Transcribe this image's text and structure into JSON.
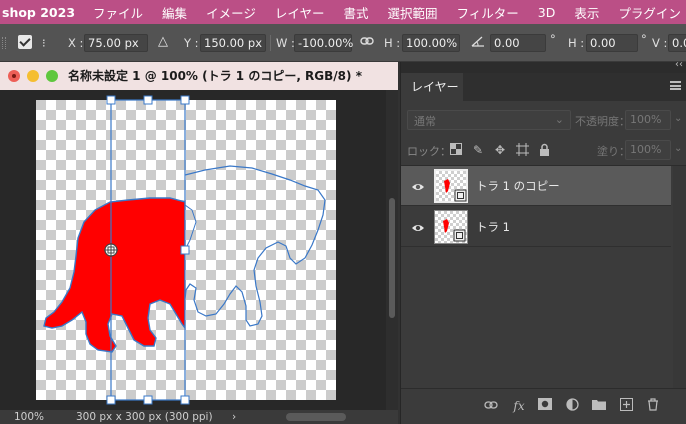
{
  "menubar": {
    "app_name": "shop 2023",
    "items": [
      "ファイル",
      "編集",
      "イメージ",
      "レイヤー",
      "書式",
      "選択範囲",
      "フィルター",
      "3D",
      "表示",
      "プラグイン"
    ]
  },
  "options": {
    "x_label": "X :",
    "x_value": "75.00 px",
    "y_label": "Y :",
    "y_value": "150.00 px",
    "w_label": "W :",
    "w_value": "-100.00%",
    "h_label": "H :",
    "h_value": "100.00%",
    "angle_value": "0.00",
    "angle_unit": "°",
    "hskew_label": "H :",
    "hskew_value": "0.00",
    "hskew_unit": "°",
    "vskew_label": "V :",
    "vskew_value": "0.0"
  },
  "document": {
    "title": "名称未設定 1 @ 100% (トラ 1 のコピー, RGB/8) *",
    "zoom": "100%",
    "size_info": "300 px x 300 px (300 ppi)",
    "status_arrow": "›"
  },
  "layers_panel": {
    "tab_label": "レイヤー",
    "collapse_glyph": "‹‹",
    "blend_mode": "通常",
    "opacity_label": "不透明度：",
    "opacity_value": "100%",
    "lock_label": "ロック：",
    "fill_label": "塗り：",
    "fill_value": "100%",
    "layers": [
      {
        "name": "トラ 1 のコピー",
        "selected": true
      },
      {
        "name": "トラ 1",
        "selected": false
      }
    ]
  },
  "colors": {
    "menubar": "#bb4f86",
    "selection_outline": "#3a78c8",
    "tiger_fill": "#ff0000"
  }
}
